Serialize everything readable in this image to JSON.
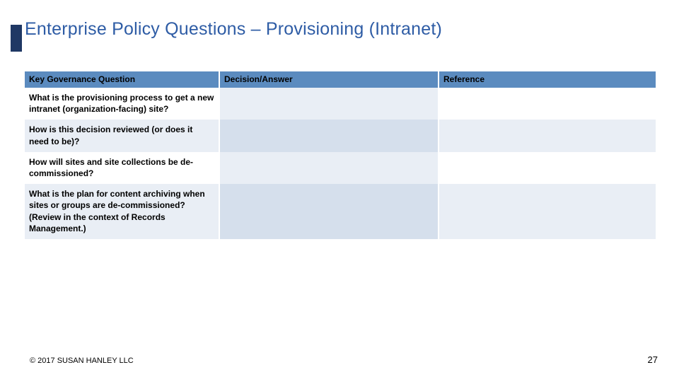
{
  "title": "Enterprise Policy Questions – Provisioning (Intranet)",
  "table": {
    "headers": {
      "c1": "Key Governance Question",
      "c2": "Decision/Answer",
      "c3": "Reference"
    },
    "rows": [
      {
        "q": "What is the provisioning process to get a new intranet (organization-facing) site?",
        "d": "",
        "r": ""
      },
      {
        "q": "How is this decision reviewed (or does it need to be)?",
        "d": "",
        "r": ""
      },
      {
        "q": "How will sites and site collections be de-commissioned?",
        "d": "",
        "r": ""
      },
      {
        "q": "What is the plan for content archiving when sites or groups are de-commissioned? (Review in the context of Records Management.)",
        "d": "",
        "r": ""
      }
    ]
  },
  "footer": {
    "copyright": "© 2017 SUSAN HANLEY LLC",
    "page": "27"
  }
}
